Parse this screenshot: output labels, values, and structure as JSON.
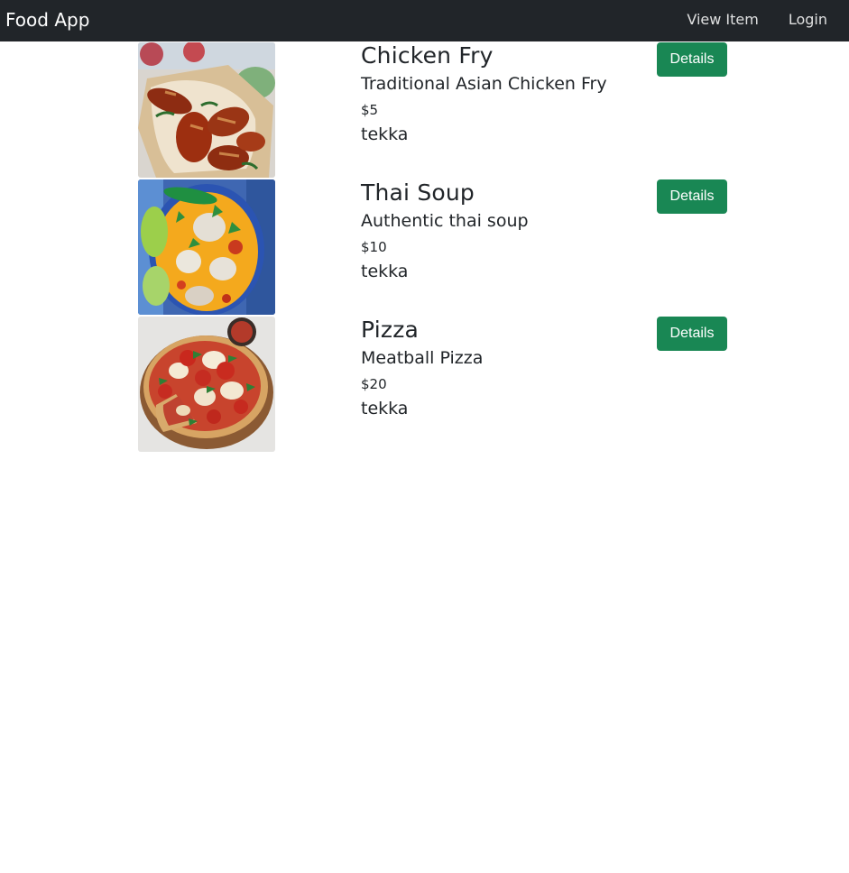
{
  "nav": {
    "brand": "Food App",
    "links": [
      "View Item",
      "Login"
    ]
  },
  "items": [
    {
      "title": "Chicken Fry",
      "description": "Traditional Asian Chicken Fry",
      "price": "$5",
      "owner": "tekka",
      "button": "Details",
      "image": "chicken-fry-photo"
    },
    {
      "title": "Thai Soup",
      "description": "Authentic thai soup",
      "price": "$10",
      "owner": "tekka",
      "button": "Details",
      "image": "thai-soup-photo"
    },
    {
      "title": "Pizza",
      "description": "Meatball Pizza",
      "price": "$20",
      "owner": "tekka",
      "button": "Details",
      "image": "pizza-photo"
    }
  ],
  "colors": {
    "navbar": "#212529",
    "success": "#198754",
    "text": "#212529"
  }
}
